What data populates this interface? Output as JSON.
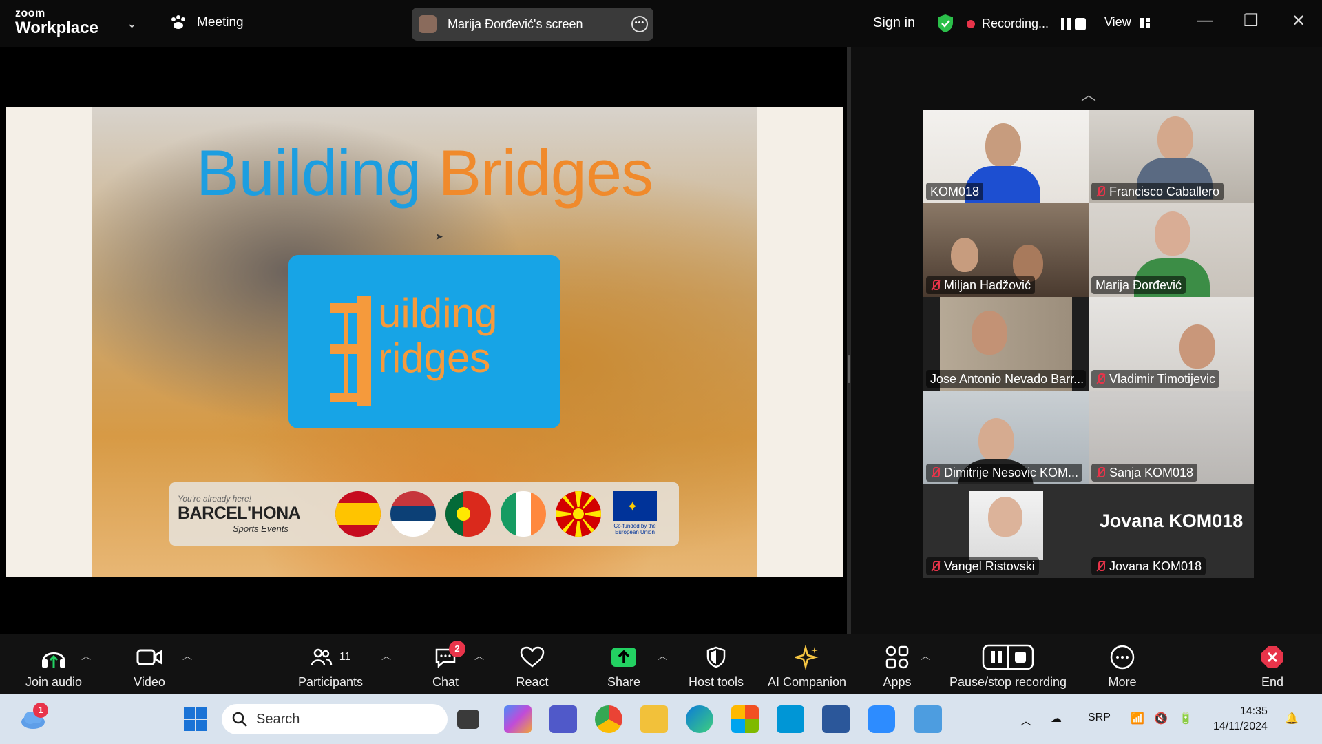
{
  "app": {
    "logo_line1": "zoom",
    "logo_line2": "Workplace",
    "meeting_label": "Meeting",
    "screen_share_label": "Marija Đorđević's screen",
    "sign_in": "Sign in",
    "recording_label": "Recording...",
    "view_label": "View"
  },
  "slide": {
    "title_part1": "Building",
    "title_part2": "Bridges",
    "logo_text_line1": "uilding",
    "logo_text_line2": "ridges",
    "partner_tagline": "You're already here!",
    "partner_name": "BARCEL'HONA",
    "partner_sub": "Sports Events",
    "eu_text": "Co-funded by the European Union"
  },
  "participants": [
    {
      "name": "KOM018",
      "muted": false
    },
    {
      "name": "Francisco Caballero",
      "muted": true
    },
    {
      "name": "Miljan Hadžović",
      "muted": true
    },
    {
      "name": "Marija Đorđević",
      "muted": false,
      "active": true
    },
    {
      "name": "Jose Antonio Nevado Barr...",
      "muted": false
    },
    {
      "name": "Vladimir Timotijevic",
      "muted": true
    },
    {
      "name": "Dimitrije Nesovic KOM...",
      "muted": true
    },
    {
      "name": "Sanja KOM018",
      "muted": true
    },
    {
      "name": "Vangel Ristovski",
      "muted": true
    },
    {
      "name": "Jovana KOM018",
      "muted": true,
      "display_name": "Jovana KOM018"
    }
  ],
  "toolbar": {
    "join_audio": "Join audio",
    "video": "Video",
    "participants": "Participants",
    "participants_count": "11",
    "chat": "Chat",
    "chat_badge": "2",
    "react": "React",
    "share": "Share",
    "host_tools": "Host tools",
    "ai_companion": "AI Companion",
    "apps": "Apps",
    "pause_stop_recording": "Pause/stop recording",
    "more": "More",
    "end": "End"
  },
  "taskbar": {
    "weather_badge": "1",
    "search_placeholder": "Search",
    "language": "SRP",
    "time": "14:35",
    "date": "14/11/2024"
  },
  "colors": {
    "accent_blue": "#1d9ee0",
    "accent_orange": "#f08a2c",
    "active_speaker": "#2fd07a",
    "recording_red": "#e8344a",
    "share_green": "#23d162"
  }
}
